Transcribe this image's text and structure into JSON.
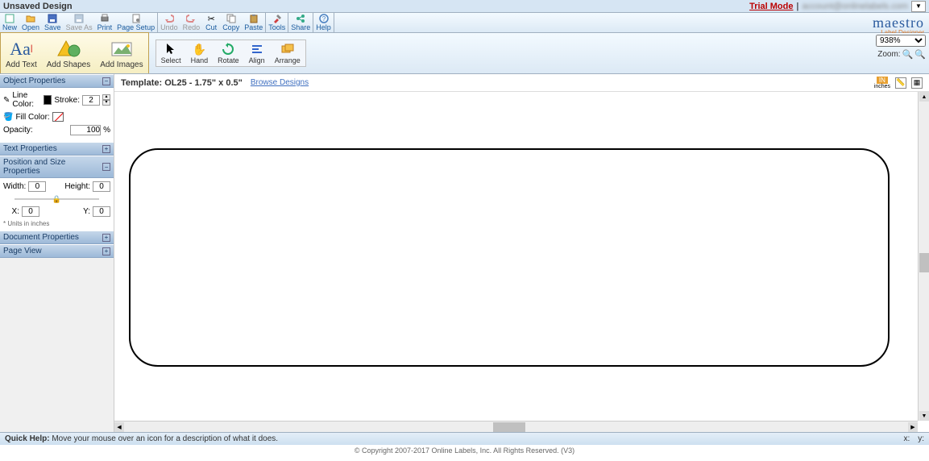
{
  "title": "Unsaved Design",
  "trial_mode": "Trial Mode",
  "user_email": "account@onlinelabels.com",
  "toolbar": {
    "new": "New",
    "open": "Open",
    "save": "Save",
    "save_as": "Save As",
    "print": "Print",
    "page_setup": "Page Setup",
    "undo": "Undo",
    "redo": "Redo",
    "cut": "Cut",
    "copy": "Copy",
    "paste": "Paste",
    "tools": "Tools",
    "share": "Share",
    "help": "Help"
  },
  "logo": {
    "main": "maestro",
    "sub": "Label Designer"
  },
  "add": {
    "text": "Add Text",
    "shapes": "Add Shapes",
    "images": "Add Images"
  },
  "tools": {
    "select": "Select",
    "hand": "Hand",
    "rotate": "Rotate",
    "align": "Align",
    "arrange": "Arrange"
  },
  "zoom": {
    "value": "938%",
    "label": "Zoom:"
  },
  "panels": {
    "object": "Object Properties",
    "text": "Text Properties",
    "position": "Position and Size Properties",
    "document": "Document Properties",
    "pageview": "Page View"
  },
  "object_props": {
    "line_color": "Line Color:",
    "stroke": "Stroke:",
    "stroke_value": "2",
    "fill_color": "Fill Color:",
    "opacity": "Opacity:",
    "opacity_value": "100",
    "opacity_pct": "%"
  },
  "position_props": {
    "width": "Width:",
    "width_value": "0",
    "height": "Height:",
    "height_value": "0",
    "x": "X:",
    "x_value": "0",
    "y": "Y:",
    "y_value": "0",
    "units": "* Units in inches"
  },
  "template": {
    "label": "Template:",
    "name": "OL25 - 1.75\" x 0.5\"",
    "browse": "Browse Designs",
    "unit_label": "inches"
  },
  "help": {
    "prefix": "Quick Help:",
    "text": " Move your mouse over an icon for a description of what it does."
  },
  "coords": {
    "x": "x:",
    "y": "y:"
  },
  "footer": "© Copyright 2007-2017 Online Labels, Inc. All Rights Reserved. (V3)"
}
